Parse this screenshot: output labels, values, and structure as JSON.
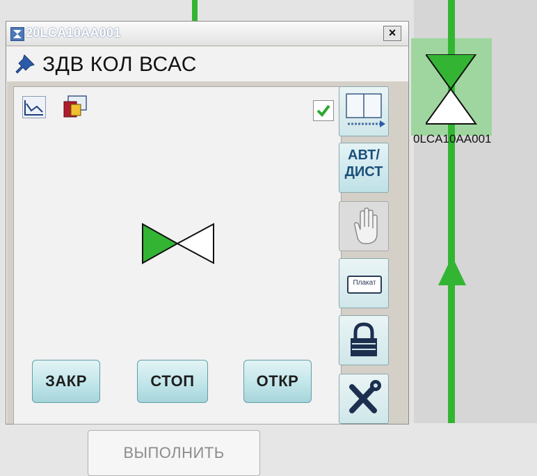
{
  "window": {
    "title": "20LCA10AA001",
    "close_label": "×",
    "subtitle": "ЗДВ КОЛ ВСАС"
  },
  "commands": {
    "close": "ЗАКР",
    "stop": "СТОП",
    "open": "ОТКР",
    "execute": "ВЫПОЛНИТЬ"
  },
  "side_buttons": {
    "avt_line1": "АВТ/",
    "avt_line2": "ДИСТ",
    "plaket": "Плакат"
  },
  "background": {
    "tag": "0LCA10AA001"
  },
  "icons": {
    "title": "valve-icon",
    "pin": "pin-icon",
    "trend": "trend-icon",
    "faceplate": "faceplate-icon",
    "check": "check-icon",
    "hand": "hand-icon",
    "lock": "lock-icon",
    "tools": "tools-icon",
    "panel": "panel-arrows-icon"
  },
  "colors": {
    "valve_green": "#33b533",
    "button_teal": "#c2e6ea",
    "title_blue": "#4c78b8"
  }
}
